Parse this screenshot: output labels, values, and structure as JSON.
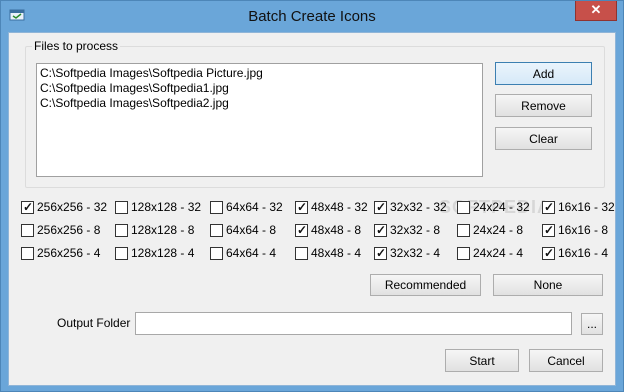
{
  "window": {
    "title": "Batch Create Icons",
    "close_glyph": "✕"
  },
  "files": {
    "group_title": "Files to process",
    "items": [
      "C:\\Softpedia Images\\Softpedia Picture.jpg",
      "C:\\Softpedia Images\\Softpedia1.jpg",
      "C:\\Softpedia Images\\Softpedia2.jpg"
    ],
    "add_label": "Add",
    "remove_label": "Remove",
    "clear_label": "Clear"
  },
  "formats": {
    "rows": [
      {
        "items": [
          {
            "label": "256x256 - 32",
            "checked": true
          },
          {
            "label": "128x128 - 32",
            "checked": false
          },
          {
            "label": "64x64 - 32",
            "checked": false
          },
          {
            "label": "48x48 - 32",
            "checked": true
          },
          {
            "label": "32x32 - 32",
            "checked": true
          },
          {
            "label": "24x24 - 32",
            "checked": false
          },
          {
            "label": "16x16 - 32",
            "checked": true
          }
        ]
      },
      {
        "items": [
          {
            "label": "256x256 - 8",
            "checked": false
          },
          {
            "label": "128x128 - 8",
            "checked": false
          },
          {
            "label": "64x64 - 8",
            "checked": false
          },
          {
            "label": "48x48 - 8",
            "checked": true
          },
          {
            "label": "32x32 - 8",
            "checked": true
          },
          {
            "label": "24x24 - 8",
            "checked": false
          },
          {
            "label": "16x16 - 8",
            "checked": true
          }
        ]
      },
      {
        "items": [
          {
            "label": "256x256 - 4",
            "checked": false
          },
          {
            "label": "128x128 - 4",
            "checked": false
          },
          {
            "label": "64x64 - 4",
            "checked": false
          },
          {
            "label": "48x48 - 4",
            "checked": false
          },
          {
            "label": "32x32 - 4",
            "checked": true
          },
          {
            "label": "24x24 - 4",
            "checked": false
          },
          {
            "label": "16x16 - 4",
            "checked": true
          }
        ]
      }
    ],
    "recommended_label": "Recommended",
    "none_label": "None"
  },
  "output": {
    "label": "Output Folder",
    "value": "",
    "browse_label": "..."
  },
  "actions": {
    "start_label": "Start",
    "cancel_label": "Cancel"
  },
  "watermark": "SOFTPEDIA",
  "icons": {
    "app": "window-icon",
    "close": "close-icon"
  },
  "colors": {
    "title_bar": "#6aa6d9",
    "close": "#c7504a",
    "client": "#f0f0f0"
  }
}
